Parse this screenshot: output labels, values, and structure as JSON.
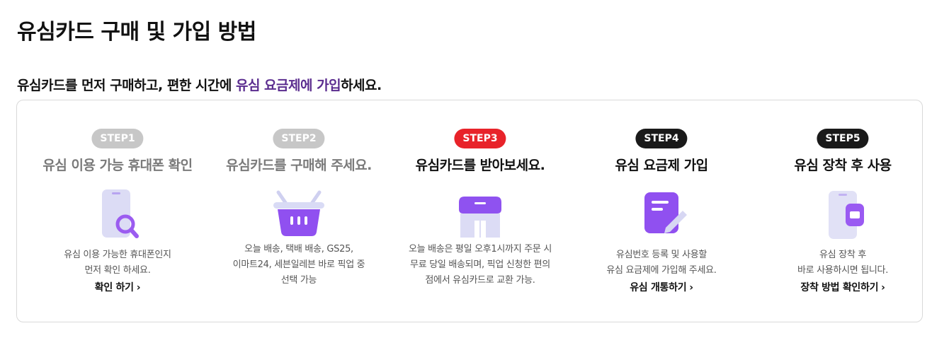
{
  "page": {
    "title": "유심카드 구매 및 가입 방법",
    "subtitle_prefix": "유심카드를 먼저 구매하고, 편한 시간에 ",
    "subtitle_highlight": "유심 요금제에 가입",
    "subtitle_suffix": "하세요.",
    "highlight_color": "#5b2d8f"
  },
  "steps": [
    {
      "badge": "STEP1",
      "badge_color": "#c7c7c7",
      "title": "유심 이용 가능 휴대폰 확인",
      "icon": "phone-search-icon",
      "desc": [
        "유심 이용 가능한 휴대폰인지",
        "먼저 확인 하세요."
      ],
      "link": "확인 하기"
    },
    {
      "badge": "STEP2",
      "badge_color": "#c7c7c7",
      "title": "유심카드를 구매해 주세요.",
      "icon": "shopping-basket-icon",
      "desc": [
        "오늘 배송, 택배 배송, GS25,",
        "이마트24, 세븐일레븐 바로 픽업 중",
        "선택 가능"
      ]
    },
    {
      "badge": "STEP3",
      "badge_color": "#e8232a",
      "title": "유심카드를 받아보세요.",
      "icon": "store-icon",
      "desc": [
        "오늘 배송은 평일 오후1시까지 주문 시",
        "무료 당일 배송되며, 픽업 신청한 편의",
        "점에서 유심카드로 교환 가능."
      ]
    },
    {
      "badge": "STEP4",
      "badge_color": "#1a1a1a",
      "title": "유심 요금제 가입",
      "icon": "document-edit-icon",
      "desc": [
        "유심번호 등록 및 사용할",
        "유심 요금제에 가입해 주세요."
      ],
      "link": "유심 개통하기"
    },
    {
      "badge": "STEP5",
      "badge_color": "#1a1a1a",
      "title": "유심 장착 후 사용",
      "icon": "phone-sim-icon",
      "desc": [
        "유심 장착 후",
        "바로 사용하시면 됩니다."
      ],
      "link": "장착 방법 확인하기"
    }
  ]
}
